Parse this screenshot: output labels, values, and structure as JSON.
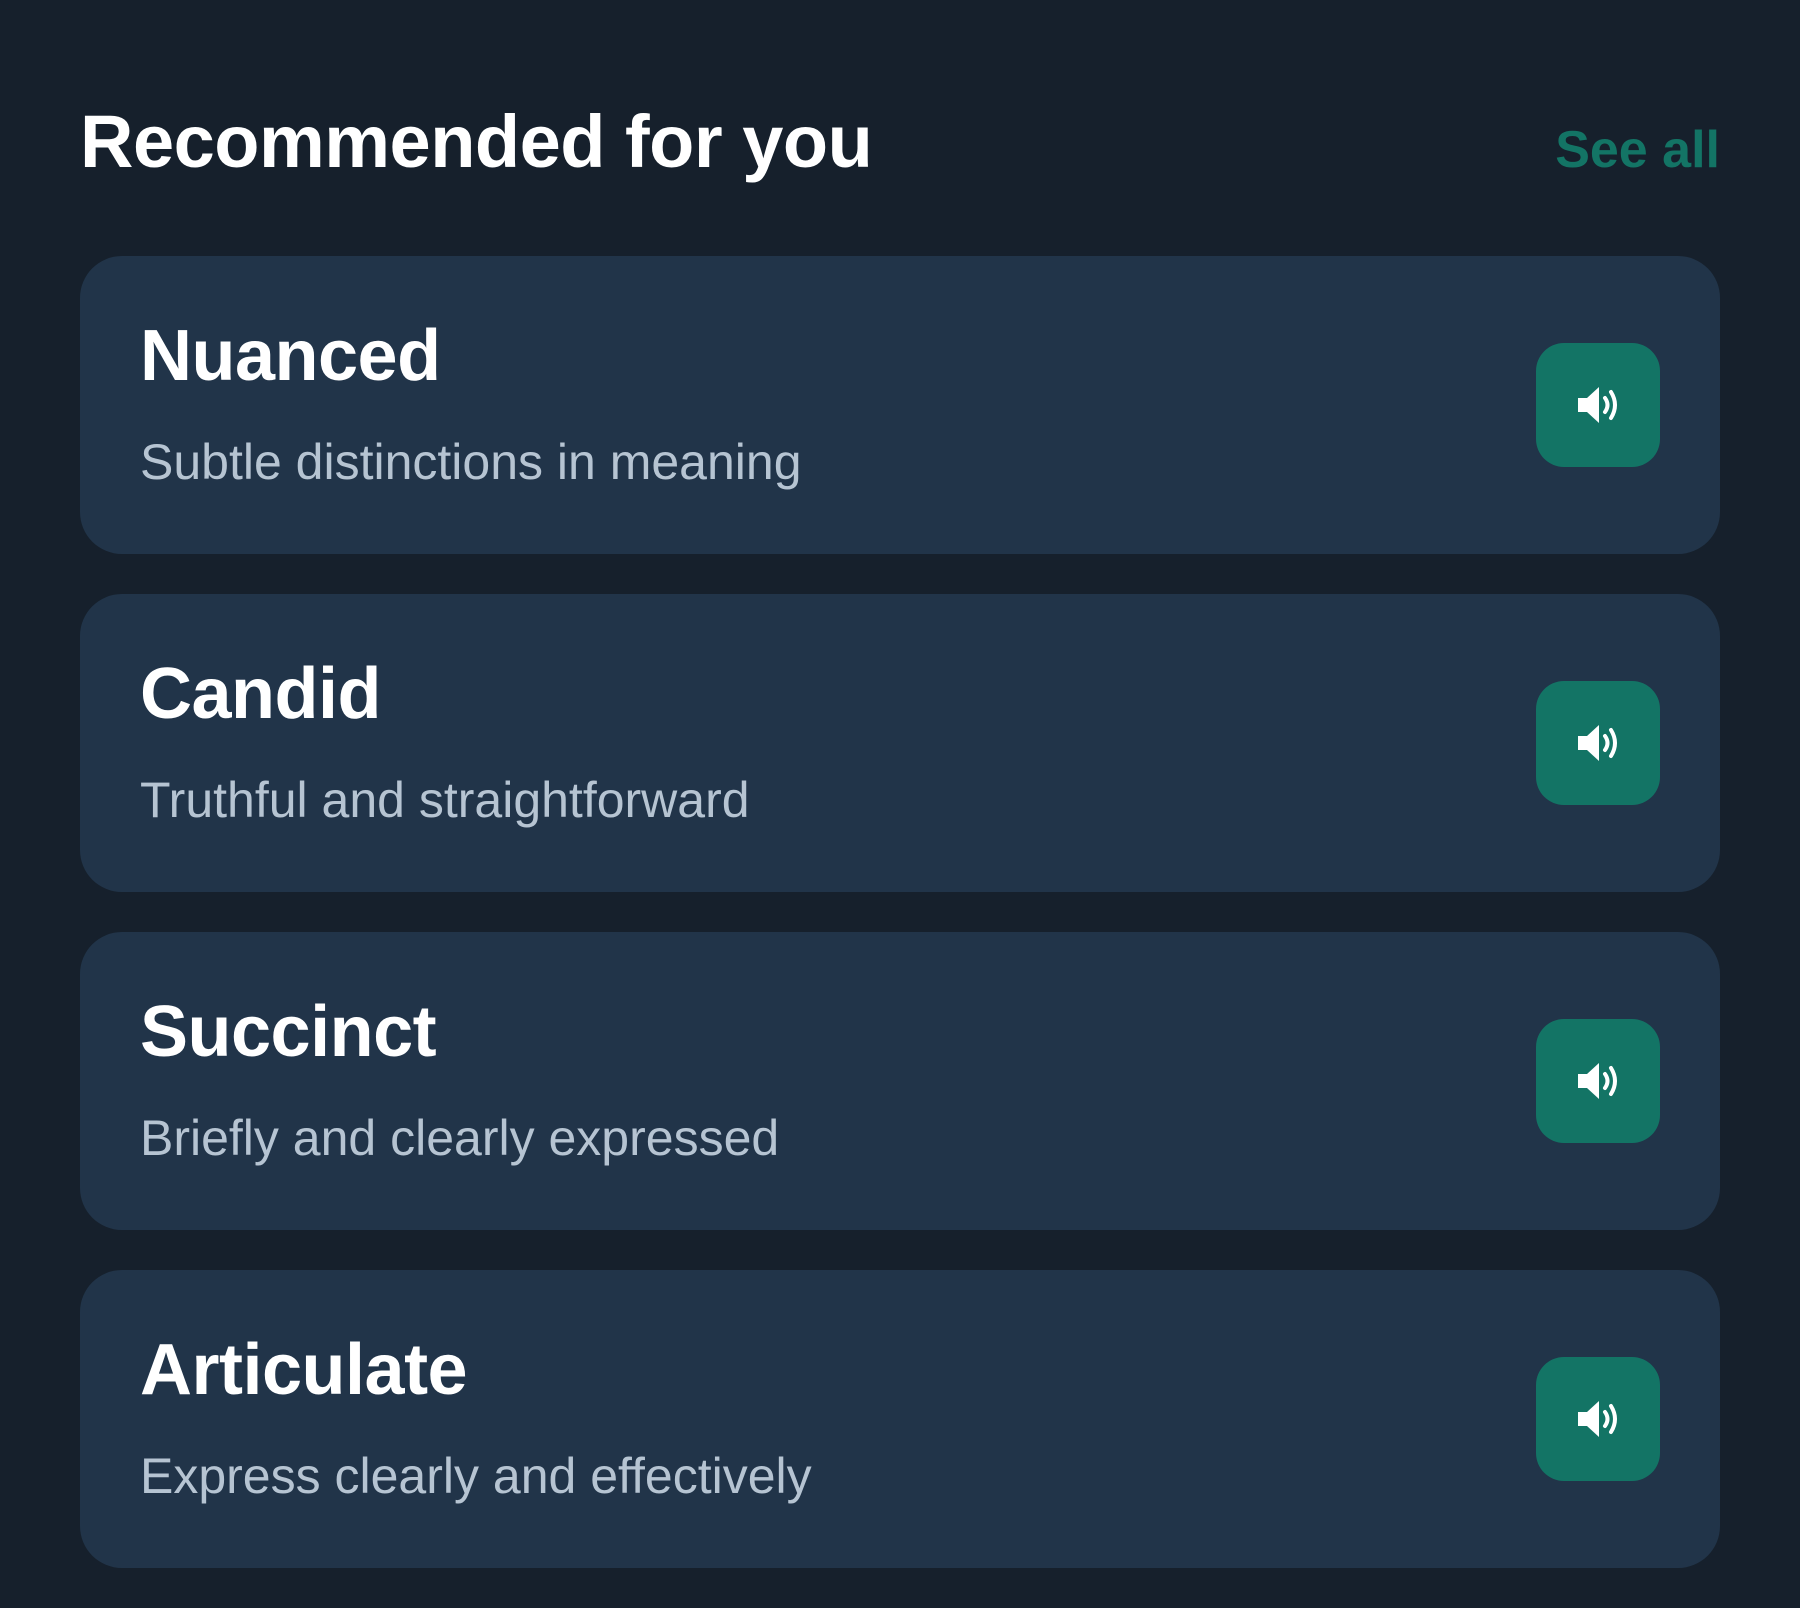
{
  "header": {
    "title": "Recommended for you",
    "see_all_label": "See all"
  },
  "cards": [
    {
      "word": "Nuanced",
      "definition": "Subtle distinctions in meaning",
      "icon": "speaker-icon"
    },
    {
      "word": "Candid",
      "definition": "Truthful and straightforward",
      "icon": "speaker-icon"
    },
    {
      "word": "Succinct",
      "definition": "Briefly and clearly expressed",
      "icon": "speaker-icon"
    },
    {
      "word": "Articulate",
      "definition": "Express clearly and effectively",
      "icon": "speaker-icon"
    }
  ],
  "colors": {
    "background": "#16202c",
    "card": "#213449",
    "accent": "#137465",
    "title_text": "#ffffff",
    "definition_text": "#b6c4d2"
  }
}
